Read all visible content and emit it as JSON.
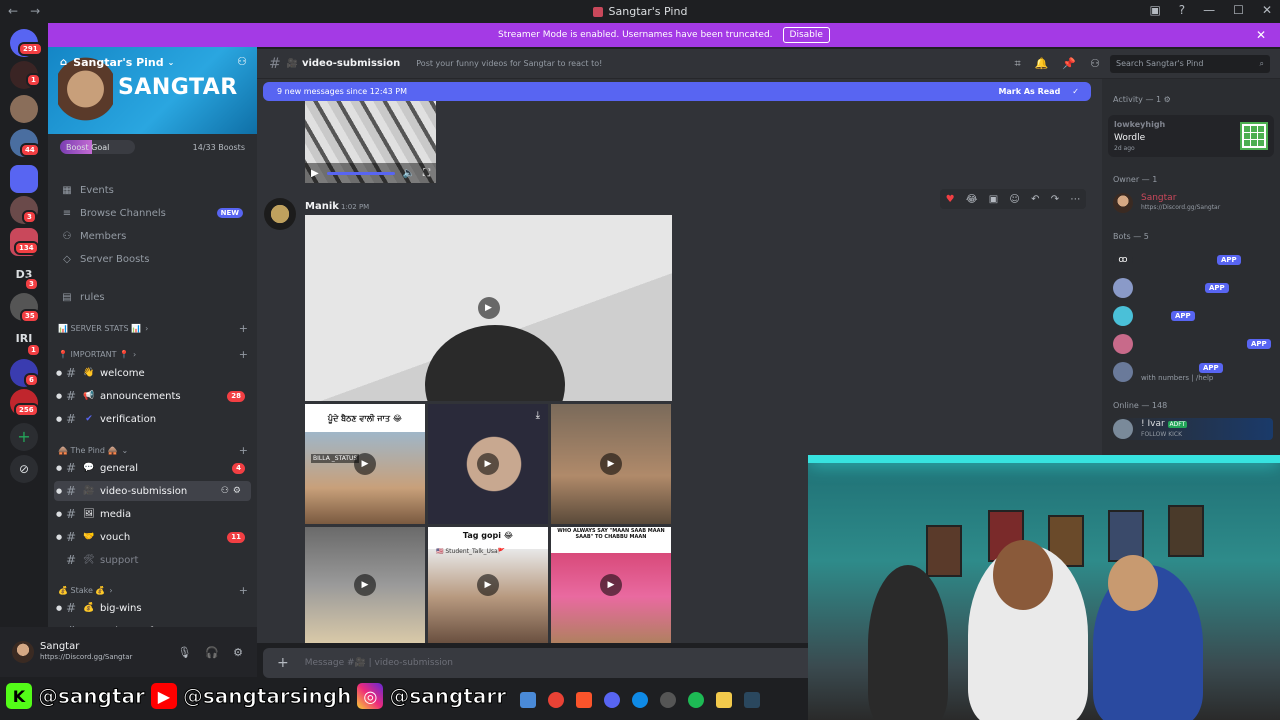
{
  "window": {
    "title": "Sangtar's Pind"
  },
  "streamer_banner": {
    "text": "Streamer Mode is enabled. Usernames have been truncated.",
    "disable_label": "Disable"
  },
  "server": {
    "name": "Sangtar's Pind",
    "banner_text": "SANGTAR",
    "boost_goal_label": "Boost Goal",
    "boost_count": "14/33 Boosts",
    "boost_progress": 0.42
  },
  "rail": {
    "badges": [
      "291",
      "1",
      "44",
      "3",
      "134",
      "3",
      "35",
      "1",
      "6",
      "256"
    ],
    "labels": [
      "D3",
      "IRI"
    ]
  },
  "sidebar": {
    "nav": [
      {
        "icon": "calendar-icon",
        "label": "Events"
      },
      {
        "icon": "browse-channels-icon",
        "label": "Browse Channels",
        "badge": "NEW"
      },
      {
        "icon": "members-icon",
        "label": "Members"
      },
      {
        "icon": "boost-icon",
        "label": "Server Boosts"
      },
      {
        "icon": "rules-icon",
        "label": "rules"
      }
    ],
    "categories": [
      {
        "label": "📊 SERVER STATS 📊"
      },
      {
        "label": "📍 IMPORTANT 📍"
      },
      {
        "label": "🛖 The Pind 🛖"
      },
      {
        "label": "💰 Stake 💰"
      }
    ],
    "channels": [
      {
        "emoji": "👋",
        "name": "welcome"
      },
      {
        "emoji": "📢",
        "name": "announcements",
        "count": "28"
      },
      {
        "emoji": "✔",
        "name": "verification"
      },
      {
        "emoji": "💬",
        "name": "general",
        "count": "4"
      },
      {
        "emoji": "🎥",
        "name": "video-submission"
      },
      {
        "emoji": "🖼",
        "name": "media"
      },
      {
        "emoji": "🤝",
        "name": "vouch",
        "count": "11"
      },
      {
        "emoji": "🛠",
        "name": "support"
      },
      {
        "emoji": "💰",
        "name": "big-wins"
      },
      {
        "emoji": "✔",
        "name": "stakeproof"
      }
    ]
  },
  "user": {
    "name": "Sangtar",
    "status": "https://Discord.gg/Sangtar"
  },
  "channel_header": {
    "name": "video-submission",
    "topic": "Post your funny videos for Sangtar to react to!",
    "search_placeholder": "Search Sangtar's Pind"
  },
  "new_messages": {
    "text": "9 new messages since 12:43 PM",
    "mark_label": "Mark As Read"
  },
  "message": {
    "author": "Manik",
    "time": "1:02 PM"
  },
  "videos": [
    {
      "caption": "",
      "sub": ""
    },
    {
      "caption": "ਪੂੰਦੇ ਬੈਠਣ ਵਾਲੀ ਜਾਤ 😂",
      "sub": "BILLA _STATUS"
    },
    {
      "caption": "",
      "sub": ""
    },
    {
      "caption": "",
      "sub": ""
    },
    {
      "caption": "",
      "sub": ""
    },
    {
      "caption": "Tag gopi 😂",
      "sub": "🇺🇸 Student_Talk_Usa🚩"
    },
    {
      "caption": "WHO ALWAYS SAY \"MAAN SAAB MAAN SAAB\" TO CHABBU MAAN",
      "sub": ""
    }
  ],
  "composer": {
    "placeholder": "Message #🎥 | video-submission"
  },
  "members": {
    "activity_label": "Activity — 1",
    "activity": {
      "user": "lowkeyhigh",
      "game": "Wordle",
      "time": "2d ago"
    },
    "owner_label": "Owner — 1",
    "owner": {
      "name": "Sangtar",
      "status": "https://Discord.gg/Sangtar"
    },
    "bots_label": "Bots — 5",
    "bots": [
      {
        "name": "",
        "badge": "APP"
      },
      {
        "name": "",
        "badge": "APP"
      },
      {
        "name": "",
        "badge": "APP"
      },
      {
        "name": "",
        "badge": "APP"
      },
      {
        "name": "with numbers | /help",
        "badge": "APP"
      }
    ],
    "online_label": "Online — 148",
    "online": [
      {
        "name": "! Ivar",
        "tag": "ADFT",
        "status": "FOLLOW KICK"
      }
    ]
  },
  "overlay": {
    "kick": "@sangtar",
    "youtube": "@sangtarsingh",
    "instagram": "@sangtarr"
  },
  "colors": {
    "accent": "#5865f2",
    "streamer": "#a43ae5",
    "badge": "#f23f43",
    "owner": "#c9485b"
  }
}
